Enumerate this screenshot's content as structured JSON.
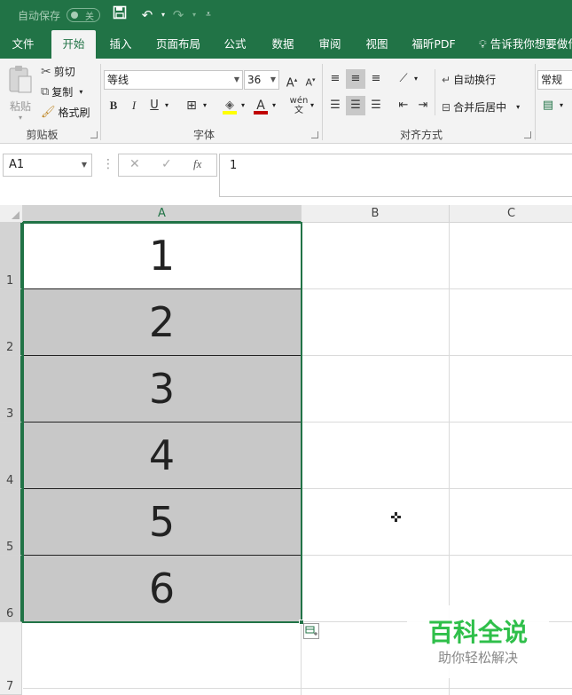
{
  "titlebar": {
    "autosave_label": "自动保存",
    "autosave_state": "关"
  },
  "tabs": [
    "文件",
    "开始",
    "插入",
    "页面布局",
    "公式",
    "数据",
    "审阅",
    "视图",
    "福昕PDF"
  ],
  "active_tab": "开始",
  "tell_me": "告诉我你想要做什",
  "clipboard": {
    "paste": "粘贴",
    "cut": "剪切",
    "copy": "复制",
    "format_painter": "格式刷",
    "group_label": "剪贴板"
  },
  "font": {
    "name": "等线",
    "size": "36",
    "group_label": "字体",
    "font_color": "#c00000",
    "fill_color": "#ffff00"
  },
  "alignment": {
    "wrap_text": "自动换行",
    "merge_center": "合并后居中",
    "group_label": "对齐方式"
  },
  "number": {
    "format": "常规"
  },
  "namebox": "A1",
  "formula": "1",
  "columns": [
    "A",
    "B",
    "C"
  ],
  "rows": [
    "1",
    "2",
    "3",
    "4",
    "5",
    "6",
    "7"
  ],
  "cells_A": [
    "1",
    "2",
    "3",
    "4",
    "5",
    "6"
  ],
  "colors": {
    "excel_green": "#217346",
    "selection_fill": "#c8c8c8"
  }
}
